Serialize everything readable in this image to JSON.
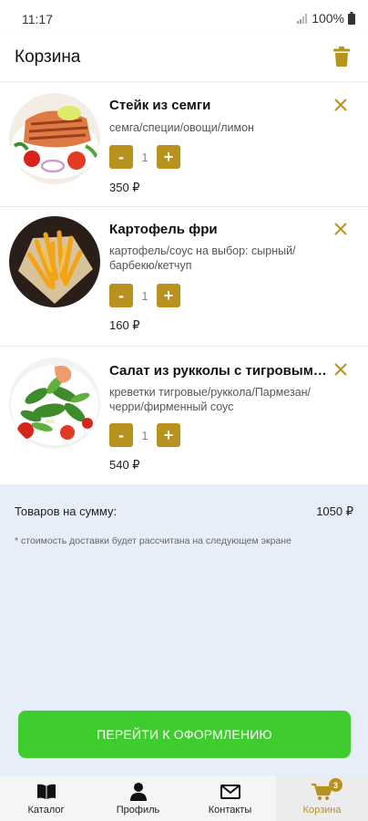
{
  "status_bar": {
    "time": "11:17",
    "battery": "100%"
  },
  "header": {
    "title": "Корзина"
  },
  "cart": {
    "items": [
      {
        "name": "Стейк из семги",
        "description": "семга/специи/овощи/лимон",
        "quantity": "1",
        "price": "350 ₽"
      },
      {
        "name": "Картофель фри",
        "description": "картофель/соус на выбор: сырный/барбекю/кетчуп",
        "quantity": "1",
        "price": "160 ₽"
      },
      {
        "name": "Салат из рукколы с тигровыми креветками",
        "description": "креветки тигровые/руккола/Пармезан/черри/фирменный соус",
        "quantity": "1",
        "price": "540 ₽"
      }
    ],
    "minus_label": "-",
    "plus_label": "+"
  },
  "summary": {
    "total_label": "Товаров на сумму:",
    "total_value": "1050 ₽",
    "note": "* стоимость доставки будет рассчитана на следующем экране",
    "checkout_label": "ПЕРЕЙТИ К ОФОРМЛЕНИЮ"
  },
  "nav": {
    "items": [
      {
        "label": "Каталог",
        "icon": "book-icon"
      },
      {
        "label": "Профиль",
        "icon": "person-icon"
      },
      {
        "label": "Контакты",
        "icon": "envelope-icon"
      },
      {
        "label": "Корзина",
        "icon": "cart-icon"
      }
    ],
    "cart_badge": "3"
  },
  "colors": {
    "accent": "#b8921f",
    "checkout": "#3fcc2e",
    "summary_bg": "#e6eefa"
  }
}
